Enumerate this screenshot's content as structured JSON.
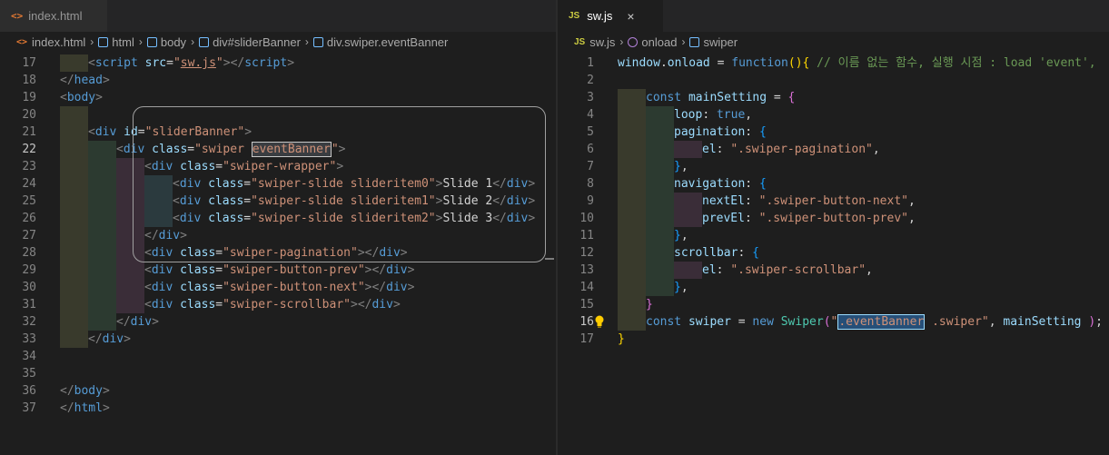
{
  "left": {
    "tab": {
      "icon": "html-file-icon",
      "icon_glyph": "<>",
      "label": "index.html"
    },
    "breadcrumb": [
      {
        "icon": "html-file-icon",
        "label": "index.html"
      },
      {
        "icon": "element-cube-icon",
        "label": "html"
      },
      {
        "icon": "element-cube-icon",
        "label": "body"
      },
      {
        "icon": "element-cube-icon",
        "label": "div#sliderBanner"
      },
      {
        "icon": "element-cube-icon",
        "label": "div.swiper.eventBanner"
      }
    ],
    "active_line": 22,
    "lines": [
      {
        "n": 17,
        "guides": 1,
        "tokens": [
          [
            "t-brk",
            "<"
          ],
          [
            "t-tag",
            "script "
          ],
          [
            "t-attr",
            "src"
          ],
          [
            "t-punc",
            "="
          ],
          [
            "t-str",
            "\""
          ],
          [
            "t-str link-u",
            "sw.js"
          ],
          [
            "t-str",
            "\""
          ],
          [
            "t-brk",
            ">"
          ],
          [
            "t-brk",
            "</"
          ],
          [
            "t-tag",
            "script"
          ],
          [
            "t-brk",
            ">"
          ]
        ]
      },
      {
        "n": 18,
        "guides": 0,
        "tokens": [
          [
            "t-brk",
            "</"
          ],
          [
            "t-tag",
            "head"
          ],
          [
            "t-brk",
            ">"
          ]
        ]
      },
      {
        "n": 19,
        "guides": 0,
        "tokens": [
          [
            "t-brk",
            "<"
          ],
          [
            "t-tag",
            "body"
          ],
          [
            "t-brk",
            ">"
          ]
        ]
      },
      {
        "n": 20,
        "guides": 1,
        "tokens": []
      },
      {
        "n": 21,
        "guides": 1,
        "tokens": [
          [
            "t-brk",
            "<"
          ],
          [
            "t-tag",
            "div "
          ],
          [
            "t-attr",
            "id"
          ],
          [
            "t-punc",
            "="
          ],
          [
            "t-str",
            "\"sliderBanner\""
          ],
          [
            "t-brk",
            ">"
          ]
        ]
      },
      {
        "n": 22,
        "guides": 2,
        "tokens": [
          [
            "t-brk",
            "<"
          ],
          [
            "t-tag",
            "div "
          ],
          [
            "t-attr",
            "class"
          ],
          [
            "t-punc",
            "="
          ],
          [
            "t-str",
            "\"swiper "
          ],
          [
            "t-str hl-box",
            "eventBanner"
          ],
          [
            "t-str",
            "\""
          ],
          [
            "t-brk",
            ">"
          ]
        ]
      },
      {
        "n": 23,
        "guides": 3,
        "tokens": [
          [
            "t-brk",
            "<"
          ],
          [
            "t-tag",
            "div "
          ],
          [
            "t-attr",
            "class"
          ],
          [
            "t-punc",
            "="
          ],
          [
            "t-str",
            "\"swiper-wrapper\""
          ],
          [
            "t-brk",
            ">"
          ]
        ]
      },
      {
        "n": 24,
        "guides": 4,
        "tokens": [
          [
            "t-brk",
            "<"
          ],
          [
            "t-tag",
            "div "
          ],
          [
            "t-attr",
            "class"
          ],
          [
            "t-punc",
            "="
          ],
          [
            "t-str",
            "\"swiper-slide slideritem0\""
          ],
          [
            "t-brk",
            ">"
          ],
          [
            "t-txt",
            "Slide 1"
          ],
          [
            "t-brk",
            "</"
          ],
          [
            "t-tag",
            "div"
          ],
          [
            "t-brk",
            ">"
          ]
        ]
      },
      {
        "n": 25,
        "guides": 4,
        "tokens": [
          [
            "t-brk",
            "<"
          ],
          [
            "t-tag",
            "div "
          ],
          [
            "t-attr",
            "class"
          ],
          [
            "t-punc",
            "="
          ],
          [
            "t-str",
            "\"swiper-slide slideritem1\""
          ],
          [
            "t-brk",
            ">"
          ],
          [
            "t-txt",
            "Slide 2"
          ],
          [
            "t-brk",
            "</"
          ],
          [
            "t-tag",
            "div"
          ],
          [
            "t-brk",
            ">"
          ]
        ]
      },
      {
        "n": 26,
        "guides": 4,
        "tokens": [
          [
            "t-brk",
            "<"
          ],
          [
            "t-tag",
            "div "
          ],
          [
            "t-attr",
            "class"
          ],
          [
            "t-punc",
            "="
          ],
          [
            "t-str",
            "\"swiper-slide slideritem2\""
          ],
          [
            "t-brk",
            ">"
          ],
          [
            "t-txt",
            "Slide 3"
          ],
          [
            "t-brk",
            "</"
          ],
          [
            "t-tag",
            "div"
          ],
          [
            "t-brk",
            ">"
          ]
        ]
      },
      {
        "n": 27,
        "guides": 3,
        "tokens": [
          [
            "t-brk",
            "</"
          ],
          [
            "t-tag",
            "div"
          ],
          [
            "t-brk",
            ">"
          ]
        ]
      },
      {
        "n": 28,
        "guides": 3,
        "tokens": [
          [
            "t-brk",
            "<"
          ],
          [
            "t-tag",
            "div "
          ],
          [
            "t-attr",
            "class"
          ],
          [
            "t-punc",
            "="
          ],
          [
            "t-str",
            "\"swiper-pagination\""
          ],
          [
            "t-brk",
            ">"
          ],
          [
            "t-brk",
            "</"
          ],
          [
            "t-tag",
            "div"
          ],
          [
            "t-brk",
            ">"
          ]
        ]
      },
      {
        "n": 29,
        "guides": 3,
        "tokens": [
          [
            "t-brk",
            "<"
          ],
          [
            "t-tag",
            "div "
          ],
          [
            "t-attr",
            "class"
          ],
          [
            "t-punc",
            "="
          ],
          [
            "t-str",
            "\"swiper-button-prev\""
          ],
          [
            "t-brk",
            ">"
          ],
          [
            "t-brk",
            "</"
          ],
          [
            "t-tag",
            "div"
          ],
          [
            "t-brk",
            ">"
          ]
        ]
      },
      {
        "n": 30,
        "guides": 3,
        "tokens": [
          [
            "t-brk",
            "<"
          ],
          [
            "t-tag",
            "div "
          ],
          [
            "t-attr",
            "class"
          ],
          [
            "t-punc",
            "="
          ],
          [
            "t-str",
            "\"swiper-button-next\""
          ],
          [
            "t-brk",
            ">"
          ],
          [
            "t-brk",
            "</"
          ],
          [
            "t-tag",
            "div"
          ],
          [
            "t-brk",
            ">"
          ]
        ]
      },
      {
        "n": 31,
        "guides": 3,
        "tokens": [
          [
            "t-brk",
            "<"
          ],
          [
            "t-tag",
            "div "
          ],
          [
            "t-attr",
            "class"
          ],
          [
            "t-punc",
            "="
          ],
          [
            "t-str",
            "\"swiper-scrollbar\""
          ],
          [
            "t-brk",
            ">"
          ],
          [
            "t-brk",
            "</"
          ],
          [
            "t-tag",
            "div"
          ],
          [
            "t-brk",
            ">"
          ]
        ]
      },
      {
        "n": 32,
        "guides": 2,
        "tokens": [
          [
            "t-brk",
            "</"
          ],
          [
            "t-tag",
            "div"
          ],
          [
            "t-brk",
            ">"
          ]
        ]
      },
      {
        "n": 33,
        "guides": 1,
        "tokens": [
          [
            "t-brk",
            "</"
          ],
          [
            "t-tag",
            "div"
          ],
          [
            "t-brk",
            ">"
          ]
        ]
      },
      {
        "n": 34,
        "guides": 0,
        "tokens": []
      },
      {
        "n": 35,
        "guides": 0,
        "tokens": []
      },
      {
        "n": 36,
        "guides": 0,
        "tokens": [
          [
            "t-brk",
            "</"
          ],
          [
            "t-tag",
            "body"
          ],
          [
            "t-brk",
            ">"
          ]
        ]
      },
      {
        "n": 37,
        "guides": 0,
        "tokens": [
          [
            "t-brk",
            "</"
          ],
          [
            "t-tag",
            "html"
          ],
          [
            "t-brk",
            ">"
          ]
        ]
      }
    ]
  },
  "right": {
    "tab": {
      "icon": "js-file-icon",
      "icon_glyph": "JS",
      "label": "sw.js",
      "close": "×"
    },
    "breadcrumb": [
      {
        "icon": "js-file-icon",
        "label": "sw.js"
      },
      {
        "icon": "function-cube-icon",
        "label": "onload"
      },
      {
        "icon": "variable-icon",
        "label": "swiper"
      }
    ],
    "active_line": 16,
    "lines": [
      {
        "n": 1,
        "guides": 0,
        "tokens": [
          [
            "t-var",
            "window"
          ],
          [
            "t-punc",
            "."
          ],
          [
            "t-var",
            "onload"
          ],
          [
            "t-punc",
            " = "
          ],
          [
            "t-kw",
            "function"
          ],
          [
            "t-b1",
            "()"
          ],
          [
            "t-b1",
            "{"
          ],
          [
            "t-cmt",
            " // 이름 없는 함수, 실행 시점 : load 'event',"
          ]
        ]
      },
      {
        "n": 2,
        "guides": 0,
        "tokens": []
      },
      {
        "n": 3,
        "guides": 1,
        "tokens": [
          [
            "t-kw",
            "const "
          ],
          [
            "t-var",
            "mainSetting"
          ],
          [
            "t-punc",
            " = "
          ],
          [
            "t-b2",
            "{"
          ]
        ]
      },
      {
        "n": 4,
        "guides": 2,
        "tokens": [
          [
            "t-var",
            "loop"
          ],
          [
            "t-punc",
            ": "
          ],
          [
            "t-bool",
            "true"
          ],
          [
            "t-punc",
            ","
          ]
        ]
      },
      {
        "n": 5,
        "guides": 2,
        "tokens": [
          [
            "t-var",
            "pagination"
          ],
          [
            "t-punc",
            ": "
          ],
          [
            "t-b3",
            "{"
          ]
        ]
      },
      {
        "n": 6,
        "guides": 3,
        "tokens": [
          [
            "t-var",
            "el"
          ],
          [
            "t-punc",
            ": "
          ],
          [
            "t-str",
            "\".swiper-pagination\""
          ],
          [
            "t-punc",
            ","
          ]
        ]
      },
      {
        "n": 7,
        "guides": 2,
        "tokens": [
          [
            "t-b3",
            "}"
          ],
          [
            "t-punc",
            ","
          ]
        ]
      },
      {
        "n": 8,
        "guides": 2,
        "tokens": [
          [
            "t-var",
            "navigation"
          ],
          [
            "t-punc",
            ": "
          ],
          [
            "t-b3",
            "{"
          ]
        ]
      },
      {
        "n": 9,
        "guides": 3,
        "tokens": [
          [
            "t-var",
            "nextEl"
          ],
          [
            "t-punc",
            ": "
          ],
          [
            "t-str",
            "\".swiper-button-next\""
          ],
          [
            "t-punc",
            ","
          ]
        ]
      },
      {
        "n": 10,
        "guides": 3,
        "tokens": [
          [
            "t-var",
            "prevEl"
          ],
          [
            "t-punc",
            ": "
          ],
          [
            "t-str",
            "\".swiper-button-prev\""
          ],
          [
            "t-punc",
            ","
          ]
        ]
      },
      {
        "n": 11,
        "guides": 2,
        "tokens": [
          [
            "t-b3",
            "}"
          ],
          [
            "t-punc",
            ","
          ]
        ]
      },
      {
        "n": 12,
        "guides": 2,
        "tokens": [
          [
            "t-var",
            "scrollbar"
          ],
          [
            "t-punc",
            ": "
          ],
          [
            "t-b3",
            "{"
          ]
        ]
      },
      {
        "n": 13,
        "guides": 3,
        "tokens": [
          [
            "t-var",
            "el"
          ],
          [
            "t-punc",
            ": "
          ],
          [
            "t-str",
            "\".swiper-scrollbar\""
          ],
          [
            "t-punc",
            ","
          ]
        ]
      },
      {
        "n": 14,
        "guides": 2,
        "tokens": [
          [
            "t-b3",
            "}"
          ],
          [
            "t-punc",
            ","
          ]
        ]
      },
      {
        "n": 15,
        "guides": 1,
        "tokens": [
          [
            "t-b2",
            "}"
          ]
        ]
      },
      {
        "n": 16,
        "guides": 1,
        "bulb": true,
        "tokens": [
          [
            "t-kw",
            "const "
          ],
          [
            "t-var",
            "swiper"
          ],
          [
            "t-punc",
            " = "
          ],
          [
            "t-kw",
            "new "
          ],
          [
            "t-cls",
            "Swiper"
          ],
          [
            "t-b2",
            "("
          ],
          [
            "t-str",
            "\""
          ],
          [
            "t-str hl-sel",
            ".eventBanner"
          ],
          [
            "t-str",
            " .swiper\""
          ],
          [
            "t-punc",
            ", "
          ],
          [
            "t-var",
            "mainSetting"
          ],
          [
            "t-punc",
            " "
          ],
          [
            "t-b2",
            ")"
          ],
          [
            "t-punc",
            ";"
          ]
        ]
      },
      {
        "n": 17,
        "guides": 0,
        "tokens": [
          [
            "t-b1",
            "}"
          ]
        ]
      }
    ]
  },
  "colors": {
    "background": "#1e1e1e",
    "tabbar": "#252526",
    "tag": "#569cd6",
    "string": "#ce9178",
    "attribute": "#9cdcfe",
    "comment": "#6a9955"
  }
}
